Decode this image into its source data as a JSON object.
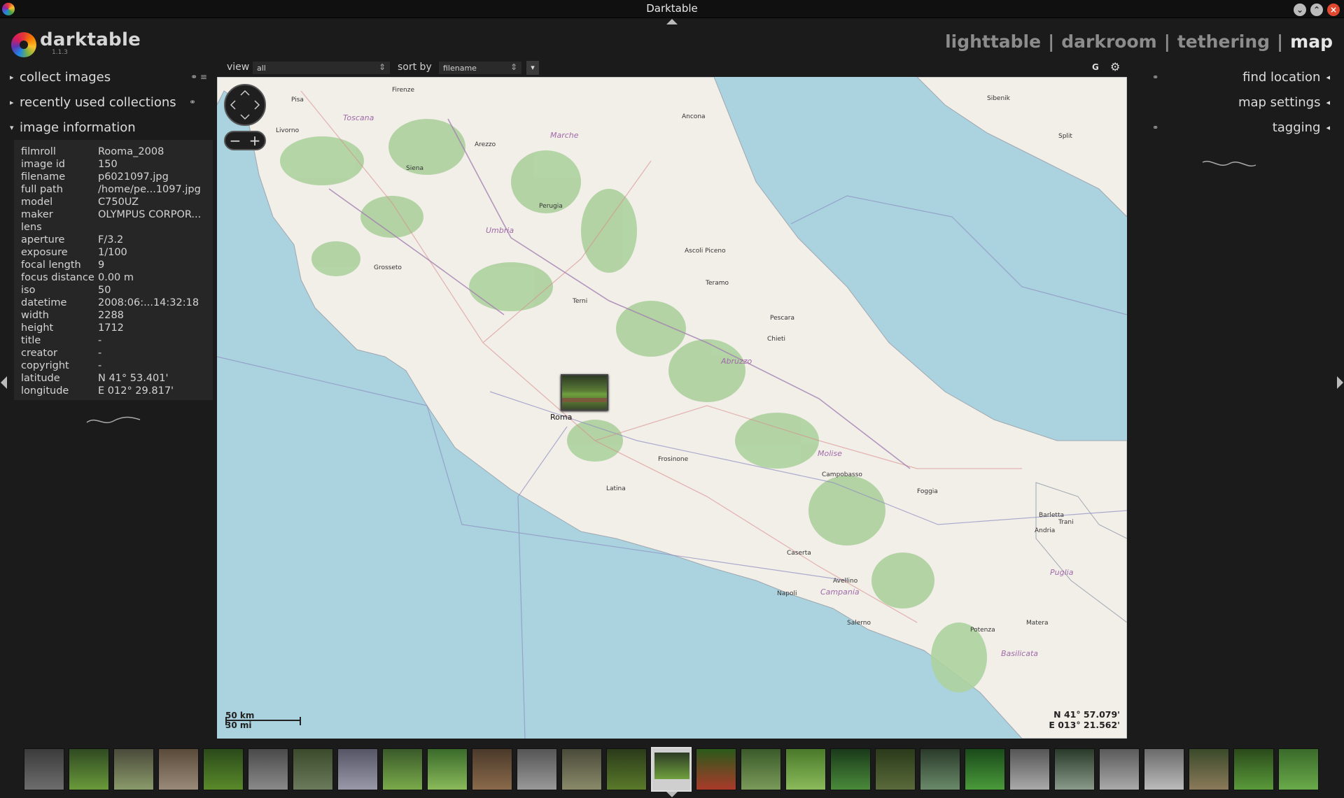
{
  "window": {
    "title": "Darktable",
    "buttons": [
      "minimize",
      "maximize",
      "close"
    ]
  },
  "app": {
    "name": "darktable",
    "version": "1.1.3"
  },
  "views": {
    "lighttable": "lighttable",
    "darkroom": "darkroom",
    "tethering": "tethering",
    "map": "map",
    "separator": "|",
    "active": "map"
  },
  "toolbar": {
    "view_label": "view",
    "view_value": "all",
    "sort_label": "sort by",
    "sort_value": "filename",
    "grouping_button": "G"
  },
  "left_panel": {
    "modules": [
      {
        "label": "collect images",
        "expanded": false
      },
      {
        "label": "recently used collections",
        "expanded": false
      },
      {
        "label": "image information",
        "expanded": true
      }
    ],
    "image_info": [
      {
        "key": "filmroll",
        "value": "Rooma_2008"
      },
      {
        "key": "image id",
        "value": "150"
      },
      {
        "key": "filename",
        "value": "p6021097.jpg"
      },
      {
        "key": "full path",
        "value": "/home/pe...1097.jpg"
      },
      {
        "key": "model",
        "value": "C750UZ"
      },
      {
        "key": "maker",
        "value": "OLYMPUS CORPOR..."
      },
      {
        "key": "lens",
        "value": ""
      },
      {
        "key": "aperture",
        "value": "F/3.2"
      },
      {
        "key": "exposure",
        "value": "1/100"
      },
      {
        "key": "focal length",
        "value": "9"
      },
      {
        "key": "focus distance",
        "value": "0.00 m"
      },
      {
        "key": "iso",
        "value": "50"
      },
      {
        "key": "datetime",
        "value": "2008:06:...14:32:18"
      },
      {
        "key": "width",
        "value": "2288"
      },
      {
        "key": "height",
        "value": "1712"
      },
      {
        "key": "title",
        "value": "-"
      },
      {
        "key": "creator",
        "value": "-"
      },
      {
        "key": "copyright",
        "value": "-"
      },
      {
        "key": "latitude",
        "value": "N 41° 53.401'"
      },
      {
        "key": "longitude",
        "value": "E 012° 29.817'"
      }
    ]
  },
  "right_panel": {
    "modules": [
      {
        "label": "find location"
      },
      {
        "label": "map settings"
      },
      {
        "label": "tagging"
      }
    ]
  },
  "map": {
    "coords_lat": "N 41° 57.079'",
    "coords_lon": "E 013° 21.562'",
    "scale_km": "50 km",
    "scale_mi": "30 mi",
    "marker_label": "Roma",
    "region_labels": [
      "Toscana",
      "Marche",
      "Umbria",
      "Abruzzo",
      "Molise",
      "Campania",
      "Puglia",
      "Basilicata"
    ],
    "city_labels": [
      "Livorno",
      "Pisa",
      "Firenze",
      "Arezzo",
      "Siena",
      "Perugia",
      "Grosseto",
      "Terni",
      "Ancona",
      "Ascoli Piceno",
      "Teramo",
      "Pescara",
      "Chieti",
      "Frosinone",
      "Latina",
      "Campobasso",
      "Foggia",
      "Caserta",
      "Napoli",
      "Salerno",
      "Avellino",
      "Potenza",
      "Matera",
      "Barletta",
      "Andria",
      "Trani",
      "Sibenik",
      "Split"
    ]
  },
  "colors": {
    "accent": "#e6e6e6",
    "panel_bg": "#1b1b1b",
    "sea": "#aad3df",
    "land": "#f2efe9",
    "forest": "#add19e"
  },
  "filmstrip": {
    "count": 29,
    "selected_index": 14
  }
}
